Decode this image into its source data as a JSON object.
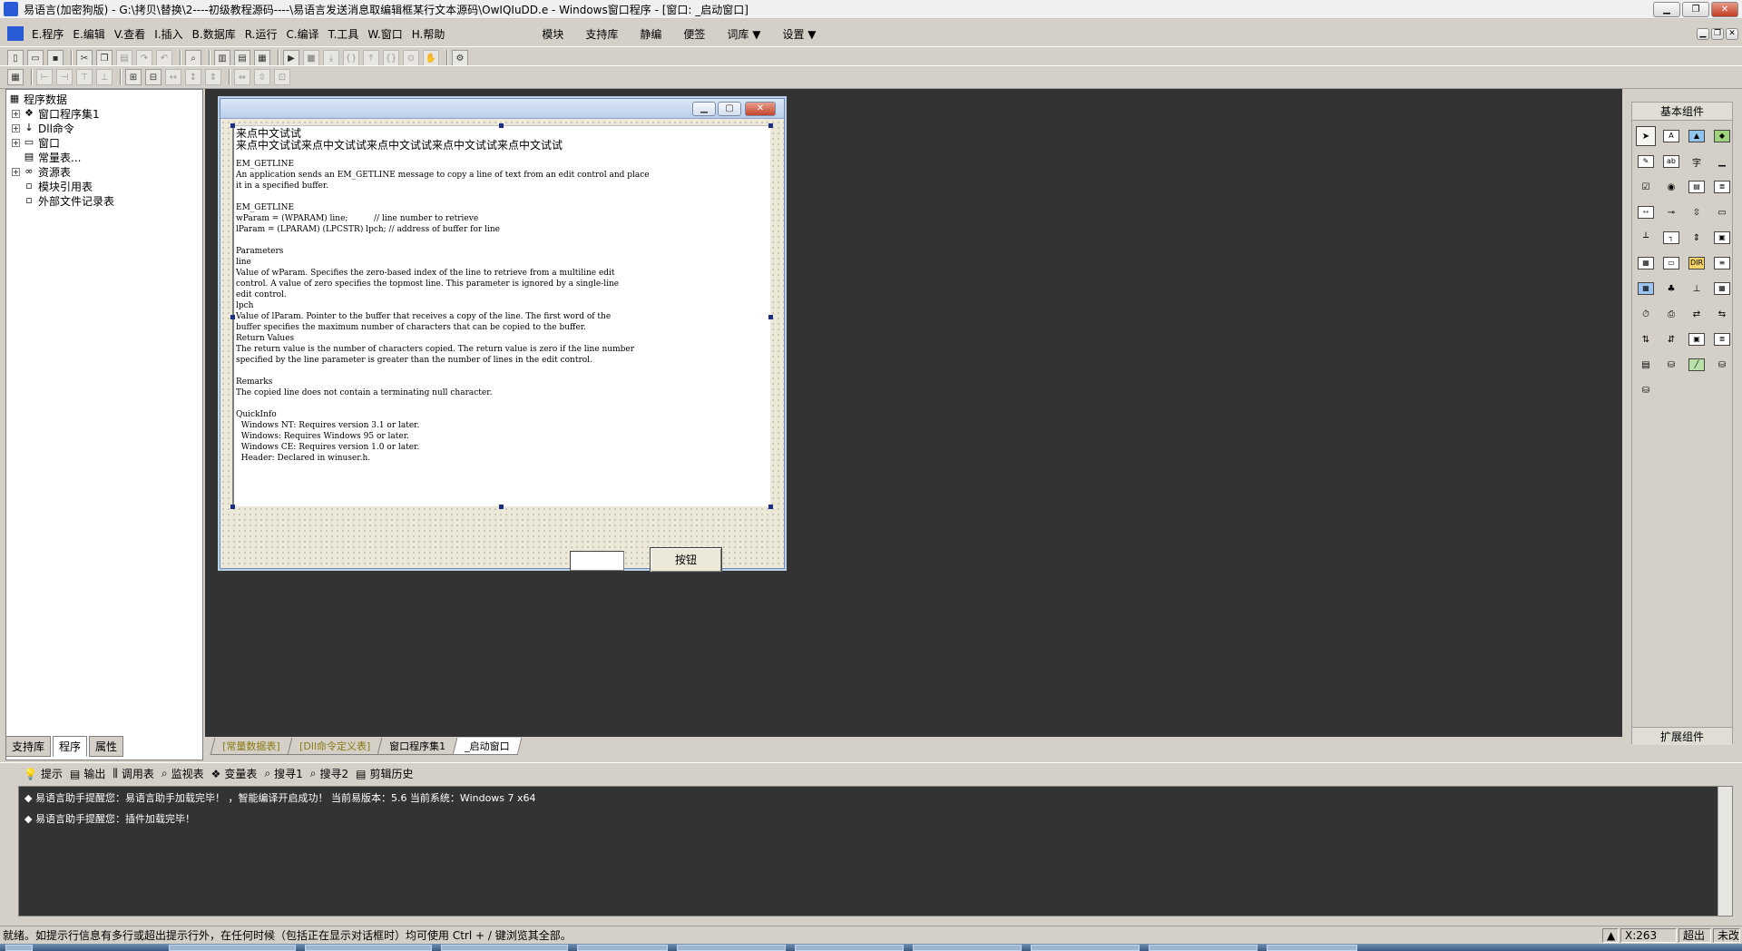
{
  "window": {
    "title": "易语言(加密狗版) - G:\\拷贝\\替换\\2----初级教程源码----\\易语言发送消息取编辑框某行文本源码\\OwIQIuDD.e - Windows窗口程序 - [窗口: _启动窗口]",
    "min_label": "▁",
    "max_label": "❐",
    "close_label": "✕"
  },
  "menubar": {
    "items": [
      "E.程序",
      "E.编辑",
      "V.查看",
      "I.插入",
      "B.数据库",
      "R.运行",
      "C.编译",
      "T.工具",
      "W.窗口",
      "H.帮助"
    ],
    "items2": [
      "模块",
      "支持库",
      "静编",
      "便签",
      "词库 ▼",
      "设置 ▼"
    ]
  },
  "tree": {
    "root": "程序数据",
    "items": [
      {
        "label": "窗口程序集1",
        "expander": "+",
        "icon": "folder-gear-icon"
      },
      {
        "label": "Dll命令",
        "expander": "+",
        "icon": "dll-icon"
      },
      {
        "label": "窗口",
        "expander": "+",
        "icon": "window-icon"
      },
      {
        "label": "常量表...",
        "expander": "",
        "icon": "constant-icon"
      },
      {
        "label": "资源表",
        "expander": "+",
        "icon": "resource-icon"
      },
      {
        "label": "模块引用表",
        "expander": "",
        "icon": "module-icon"
      },
      {
        "label": "外部文件记录表",
        "expander": "",
        "icon": "file-icon"
      }
    ]
  },
  "left_tabs": [
    "支持库",
    "程序",
    "属性"
  ],
  "form": {
    "edit_line1": "来点中文试试",
    "edit_line2": "来点中文试试来点中文试试来点中文试试来点中文试试来点中文试试",
    "edit_body": "EM_GETLINE\nAn application sends an EM_GETLINE message to copy a line of text from an edit control and place\nit in a specified buffer.\n\nEM_GETLINE\nwParam = (WPARAM) line;          // line number to retrieve\nlParam = (LPARAM) (LPCSTR) lpch; // address of buffer for line\n\nParameters\nline\nValue of wParam. Specifies the zero-based index of the line to retrieve from a multiline edit\ncontrol. A value of zero specifies the topmost line. This parameter is ignored by a single-line\nedit control.\nlpch\nValue of lParam. Pointer to the buffer that receives a copy of the line. The first word of the\nbuffer specifies the maximum number of characters that can be copied to the buffer.\nReturn Values\nThe return value is the number of characters copied. The return value is zero if the line number\nspecified by the line parameter is greater than the number of lines in the edit control.\n\nRemarks\nThe copied line does not contain a terminating null character.\n\nQuickInfo\n  Windows NT: Requires version 3.1 or later.\n  Windows: Requires Windows 95 or later.\n  Windows CE: Requires version 1.0 or later.\n  Header: Declared in winuser.h.",
    "input_value": "",
    "button_label": "按钮"
  },
  "right_panel": {
    "title": "基本组件",
    "footer": "扩展组件"
  },
  "doc_tabs": [
    {
      "label": "[常量数据表]",
      "state": "inactive"
    },
    {
      "label": "[Dll命令定义表]",
      "state": "inactive"
    },
    {
      "label": "窗口程序集1",
      "state": "normal"
    },
    {
      "label": "_启动窗口",
      "state": "active"
    }
  ],
  "output_tabs": [
    {
      "label": "提示",
      "icon": "bulb-icon"
    },
    {
      "label": "输出",
      "icon": "output-icon"
    },
    {
      "label": "调用表",
      "icon": "call-table-icon"
    },
    {
      "label": "监视表",
      "icon": "watch-icon"
    },
    {
      "label": "变量表",
      "icon": "variable-icon"
    },
    {
      "label": "搜寻1",
      "icon": "search1-icon"
    },
    {
      "label": "搜寻2",
      "icon": "search2-icon"
    },
    {
      "label": "剪辑历史",
      "icon": "clip-history-icon"
    }
  ],
  "output_lines": [
    "◆ 易语言助手提醒您：易语言助手加载完毕！ ，智能编译开启成功！  当前易版本：5.6  当前系统：Windows 7 x64",
    "◆ 易语言助手提醒您：插件加载完毕！"
  ],
  "status": {
    "text": "就绪。如提示行信息有多行或超出提示行外，在任何时候（包括正在显示对话框时）均可使用 Ctrl + / 键浏览其全部。",
    "coord": "X:263",
    "mode": "超出",
    "extra": "未改"
  }
}
